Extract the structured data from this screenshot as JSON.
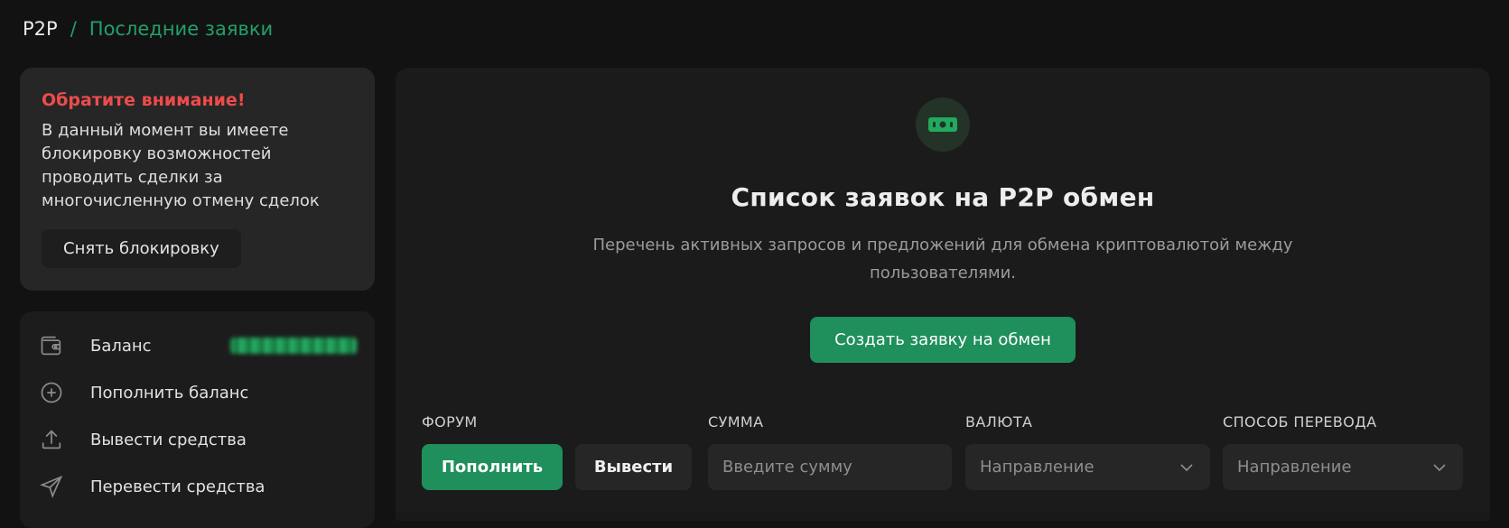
{
  "breadcrumb": {
    "root": "P2P",
    "separator": "/",
    "current": "Последние заявки"
  },
  "notice": {
    "title": "Обратите внимание!",
    "text": "В данный момент вы имеете блокировку возможностей проводить сделки за многочисленную отмену сделок",
    "button": "Снять блокировку"
  },
  "menu": {
    "items": [
      {
        "label": "Баланс",
        "icon": "wallet-icon"
      },
      {
        "label": "Пополнить баланс",
        "icon": "plus-circle-icon"
      },
      {
        "label": "Вывести средства",
        "icon": "upload-icon"
      },
      {
        "label": "Перевести средства",
        "icon": "send-icon"
      }
    ]
  },
  "main": {
    "icon": "money-icon",
    "title": "Список заявок на P2P обмен",
    "subtitle": "Перечень активных запросов и предложений для обмена криптовалютой между пользователями.",
    "create_button": "Создать заявку на обмен"
  },
  "filters": {
    "forum_label": "ФОРУМ",
    "deposit_tab": "Пополнить",
    "withdraw_tab": "Вывести",
    "amount_label": "СУММА",
    "amount_placeholder": "Введите сумму",
    "currency_label": "ВАЛЮТА",
    "currency_value": "Направление",
    "method_label": "СПОСОБ ПЕРЕВОДА",
    "method_value": "Направление"
  },
  "colors": {
    "accent": "#1f8f5c",
    "warning": "#ef4b4b",
    "background": "#121212"
  }
}
